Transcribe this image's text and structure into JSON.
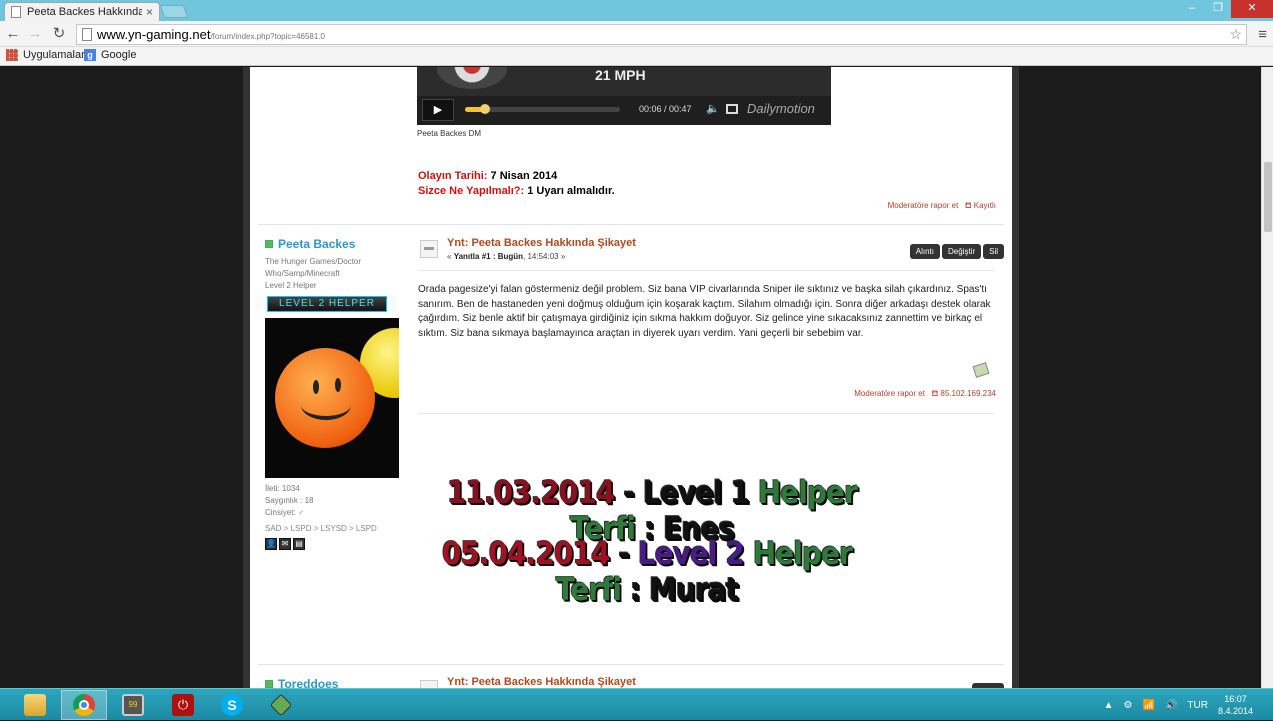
{
  "browser": {
    "tab_title": "Peeta Backes Hakkında Şi",
    "tab_close": "×",
    "url_host": "www.yn-gaming.net",
    "url_path": "/forum/index.php?topic=46581.0",
    "bookmarks": [
      "Uygulamalar",
      "Google"
    ],
    "google_icon_letter": "g",
    "win_controls": [
      "–",
      "❐",
      "✕"
    ],
    "nav": {
      "back": "←",
      "forward": "→",
      "reload": "↻",
      "star": "☆",
      "menu": "≡"
    }
  },
  "video": {
    "overlay_text": "21 MPH",
    "time": "00:06 / 00:47",
    "brand": "Dailymotion",
    "progress": 0.13,
    "caption": "Peeta Backes DM",
    "play_icon": "▶",
    "volume_icon": "🔈"
  },
  "prev_post": {
    "date_label": "Olayın Tarihi:",
    "date_value": "7 Nisan 2014",
    "action_label": "Sizce Ne Yapılmalı?:",
    "action_value": "1 Uyarı almalıdır.",
    "report_link": "Moderatöre rapor et",
    "report_extra": "Kayıtlı"
  },
  "post": {
    "author": "Peeta Backes",
    "games": "The Hunger Games/Doctor Who/Samp/Minecraft",
    "rank": "Level 2 Helper",
    "rank_badge": "LEVEL 2 HELPER",
    "stats": {
      "posts": "İleti: 1034",
      "respect": "Saygınlık : 18",
      "gender_label": "Cinsiyet:",
      "gender_icon": "♂"
    },
    "path": "SAD > LSPD > LSYSD > LSPD",
    "user_icons": [
      "👤",
      "✉",
      "▤"
    ],
    "title": "Ynt: Peeta Backes Hakkında Şikayet",
    "meta_prefix": "«",
    "meta_reply": "Yanıtla #1 : Bugün",
    "meta_time": ", 14:54:03 »",
    "buttons": [
      "Alıntı",
      "Değiştir",
      "Sil"
    ],
    "body": "Orada pagesize'yi falan göstermeniz değil problem. Siz bana VIP civarlarında Sniper ile sıktınız ve başka silah çıkardınız. Spas'tı sanırım. Ben de hastaneden yeni doğmuş olduğum için koşarak kaçtım. Silahım olmadığı için. Sonra diğer arkadaşı destek olarak çağırdım. Siz benle aktif bir çatışmaya girdiğiniz için sıkma hakkım doğuyor. Siz gelince yine sıkacaksınız zannettim ve birkaç el sıktım. Siz bana sıkmaya başlamayınca araçtan in diyerek uyarı verdim. Yani geçerli bir sebebim var.",
    "report_link": "Moderatöre rapor et",
    "ip": "85.102.169.234",
    "signature": {
      "line1": {
        "date": "11.03.2014",
        "dash": " - ",
        "level": "Level 1 ",
        "role": "Helper Terfi",
        "sep": " : ",
        "name": "Enes"
      },
      "line2": {
        "date": "05.04.2014",
        "dash": " - ",
        "level": "Level 2 ",
        "role": "Helper Terfi",
        "sep": " : ",
        "name": "Murat"
      }
    }
  },
  "next_post": {
    "author": "Toreddoes",
    "title": "Ynt: Peeta Backes Hakkında Şikayet"
  },
  "taskbar": {
    "apps": [
      "file-explorer",
      "chrome",
      "samp",
      "power",
      "skype",
      "game"
    ],
    "pc_label": "99",
    "power_glyph": "⏻",
    "skype_letter": "S",
    "tray_up": "▲",
    "tray_icons": [
      "⚙",
      "📶",
      "🔊"
    ],
    "lang": "TUR",
    "time": "16:07",
    "date": "8.4.2014"
  }
}
